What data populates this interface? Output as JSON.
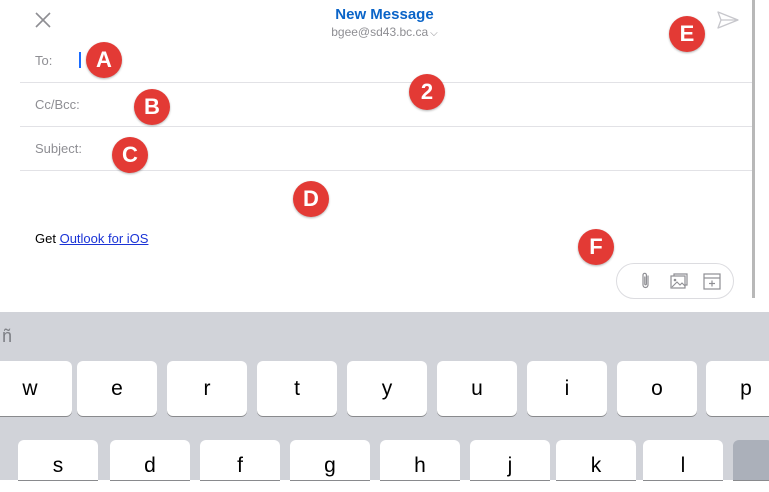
{
  "header": {
    "title": "New Message",
    "account": "bgee@sd43.bc.ca",
    "account_chevron": "⌵"
  },
  "fields": {
    "to_label": "To:",
    "cc_label": "Cc/Bcc:",
    "subject_label": "Subject:"
  },
  "body": {
    "signature_prefix": "Get ",
    "signature_link": "Outlook for iOS"
  },
  "annotations": {
    "A": "A",
    "B": "B",
    "C": "C",
    "D": "D",
    "E": "E",
    "F": "F",
    "two": "2"
  },
  "icons": {
    "close": "close-icon",
    "send": "send-icon",
    "attachment": "paperclip-icon",
    "photo": "photo-icon",
    "calendar": "calendar-icon"
  },
  "keyboard": {
    "suggestion_glyph": "ñ",
    "row1": [
      "w",
      "e",
      "r",
      "t",
      "y",
      "u",
      "i",
      "o",
      "p"
    ],
    "row2": [
      "s",
      "d",
      "f",
      "g",
      "h",
      "j",
      "k",
      "l"
    ]
  },
  "colors": {
    "title": "#0a64c8",
    "annotation_badge": "#e33a35",
    "link": "#1a33d6",
    "keyboard_bg": "#d1d3d9"
  }
}
